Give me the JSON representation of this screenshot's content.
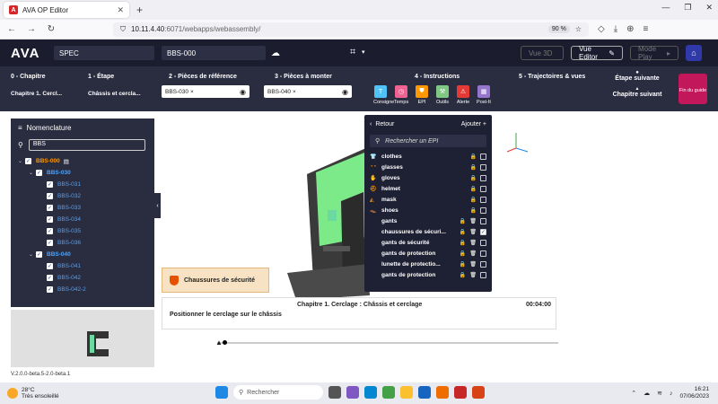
{
  "browser": {
    "tab_title": "AVA OP Editor",
    "url_host": "10.11.4.40",
    "url_port_path": ":6071/webapps/webassembly/",
    "zoom": "90 %"
  },
  "header": {
    "logo": "AVA",
    "project": "SPEC",
    "assembly": "BBS-000",
    "btn_vue3d": "Vue 3D",
    "btn_vue_editor": "Vue Editor",
    "btn_mode_play": "Mode Play"
  },
  "toolbar": {
    "chapitre_label": "0 - Chapitre",
    "chapitre_value": "Chapitre 1. Cercl...",
    "etape_label": "1 - Étape",
    "etape_value": "Châssis et cercla...",
    "pieces_ref_label": "2 - Pièces de référence",
    "pieces_ref_tag": "BBS-030",
    "pieces_monter_label": "3 - Pièces à monter",
    "pieces_monter_tag": "BBS-040",
    "instructions_label": "4 - Instructions",
    "instruction_icons": [
      {
        "label": "Consigne",
        "glyph": "T",
        "color": "#4fc3f7"
      },
      {
        "label": "Temps",
        "glyph": "◷",
        "color": "#f06292"
      },
      {
        "label": "EPI",
        "glyph": "⛊",
        "color": "#ff9800"
      },
      {
        "label": "Outils",
        "glyph": "⚒",
        "color": "#81c784"
      },
      {
        "label": "Alerte",
        "glyph": "⚠",
        "color": "#e53935"
      },
      {
        "label": "Post-It",
        "glyph": "▦",
        "color": "#9575cd"
      }
    ],
    "trajectoires_label": "5 - Trajectoires & vues",
    "etape_suivante": "Étape suivante",
    "chapitre_suivant": "Chapitre suivant",
    "fin_du_guide": "Fin du guide"
  },
  "nomenclature": {
    "title": "Nomenclature",
    "search_value": "BBS",
    "tree": [
      {
        "label": "BBS-000",
        "level": 0,
        "color": "#ff9800",
        "caret": true,
        "bold": true
      },
      {
        "label": "BBS-030",
        "level": 1,
        "color": "#4fa3f7",
        "caret": true,
        "bold": true
      },
      {
        "label": "BBS-031",
        "level": 2,
        "color": "#4fa3f7"
      },
      {
        "label": "BBS-032",
        "level": 2,
        "color": "#4fa3f7"
      },
      {
        "label": "BBS-033",
        "level": 2,
        "color": "#4fa3f7"
      },
      {
        "label": "BBS-034",
        "level": 2,
        "color": "#4fa3f7"
      },
      {
        "label": "BBS-035",
        "level": 2,
        "color": "#4fa3f7"
      },
      {
        "label": "BBS-036",
        "level": 2,
        "color": "#4fa3f7"
      },
      {
        "label": "BBS-040",
        "level": 1,
        "color": "#4fa3f7",
        "caret": true,
        "bold": true
      },
      {
        "label": "BBS-041",
        "level": 2,
        "color": "#4fa3f7"
      },
      {
        "label": "BBS-042",
        "level": 2,
        "color": "#4fa3f7"
      },
      {
        "label": "BBS-042-2",
        "level": 2,
        "color": "#4fa3f7"
      }
    ]
  },
  "epi_menu": {
    "back_label": "Retour",
    "add_label": "Ajouter",
    "search_placeholder": "Rechercher un EPI",
    "items": [
      {
        "name": "clothes",
        "icon": "👕",
        "trash": false,
        "checked": false
      },
      {
        "name": "glasses",
        "icon": "◔◔",
        "trash": false,
        "checked": false
      },
      {
        "name": "gloves",
        "icon": "✋",
        "trash": false,
        "checked": false
      },
      {
        "name": "helmet",
        "icon": "⛑",
        "trash": false,
        "checked": false
      },
      {
        "name": "mask",
        "icon": "◭",
        "trash": false,
        "checked": false
      },
      {
        "name": "shoes",
        "icon": "👞",
        "trash": false,
        "checked": false
      },
      {
        "name": "gants",
        "icon": "",
        "trash": true,
        "checked": false
      },
      {
        "name": "chaussures de sécuri...",
        "icon": "",
        "trash": true,
        "checked": true
      },
      {
        "name": "gants de sécurité",
        "icon": "",
        "trash": true,
        "checked": false
      },
      {
        "name": "gants de protection",
        "icon": "",
        "trash": true,
        "checked": false
      },
      {
        "name": "lunette de protectio...",
        "icon": "",
        "trash": true,
        "checked": false
      },
      {
        "name": "gants de protection",
        "icon": "",
        "trash": true,
        "checked": false
      }
    ]
  },
  "notice": "Chaussures de sécurité",
  "instruction": {
    "chapter": "Chapitre 1. Cerclage : Châssis et cerclage",
    "time": "00:04:00",
    "text": "Positionner le cerclage sur le châssis"
  },
  "version": "V.2.0.0-beta.5-2.0-beta.1",
  "taskbar": {
    "temp": "28°C",
    "weather": "Très ensoleillé",
    "search": "Rechercher",
    "time": "16:21",
    "date": "07/06/2023"
  }
}
